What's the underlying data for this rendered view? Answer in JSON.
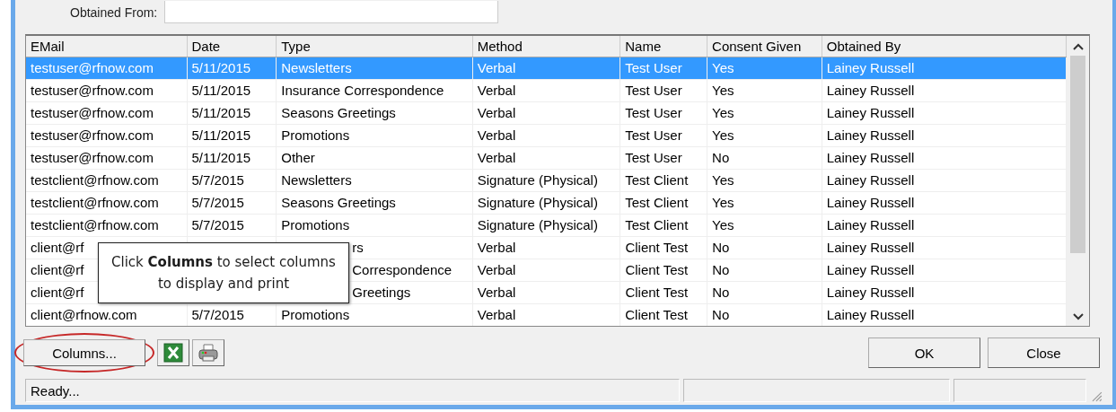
{
  "form": {
    "obtained_from_label": "Obtained From:"
  },
  "table": {
    "columns": [
      "EMail",
      "Date",
      "Type",
      "Method",
      "Name",
      "Consent Given",
      "Obtained By"
    ],
    "rows": [
      {
        "selected": true,
        "covered": false,
        "cells": [
          "testuser@rfnow.com",
          "5/11/2015",
          "Newsletters",
          "Verbal",
          "Test User",
          "Yes",
          "Lainey Russell"
        ]
      },
      {
        "selected": false,
        "covered": false,
        "cells": [
          "testuser@rfnow.com",
          "5/11/2015",
          "Insurance Correspondence",
          "Verbal",
          "Test User",
          "Yes",
          "Lainey Russell"
        ]
      },
      {
        "selected": false,
        "covered": false,
        "cells": [
          "testuser@rfnow.com",
          "5/11/2015",
          "Seasons Greetings",
          "Verbal",
          "Test User",
          "Yes",
          "Lainey Russell"
        ]
      },
      {
        "selected": false,
        "covered": false,
        "cells": [
          "testuser@rfnow.com",
          "5/11/2015",
          "Promotions",
          "Verbal",
          "Test User",
          "Yes",
          "Lainey Russell"
        ]
      },
      {
        "selected": false,
        "covered": false,
        "cells": [
          "testuser@rfnow.com",
          "5/11/2015",
          "Other",
          "Verbal",
          "Test User",
          "No",
          "Lainey Russell"
        ]
      },
      {
        "selected": false,
        "covered": false,
        "cells": [
          "testclient@rfnow.com",
          "5/7/2015",
          "Newsletters",
          "Signature (Physical)",
          "Test Client",
          "Yes",
          "Lainey Russell"
        ]
      },
      {
        "selected": false,
        "covered": false,
        "cells": [
          "testclient@rfnow.com",
          "5/7/2015",
          "Seasons Greetings",
          "Signature (Physical)",
          "Test Client",
          "Yes",
          "Lainey Russell"
        ]
      },
      {
        "selected": false,
        "covered": false,
        "cells": [
          "testclient@rfnow.com",
          "5/7/2015",
          "Promotions",
          "Signature (Physical)",
          "Test Client",
          "Yes",
          "Lainey Russell"
        ]
      },
      {
        "selected": false,
        "covered": true,
        "cells": [
          "client@rf",
          "",
          "rs",
          "Verbal",
          "Client Test",
          "No",
          "Lainey Russell"
        ]
      },
      {
        "selected": false,
        "covered": true,
        "cells": [
          "client@rf",
          "",
          "Correspondence",
          "Verbal",
          "Client Test",
          "No",
          "Lainey Russell"
        ]
      },
      {
        "selected": false,
        "covered": true,
        "cells": [
          "client@rf",
          "",
          "Greetings",
          "Verbal",
          "Client Test",
          "No",
          "Lainey Russell"
        ]
      },
      {
        "selected": false,
        "covered": false,
        "cells": [
          "client@rfnow.com",
          "5/7/2015",
          "Promotions",
          "Verbal",
          "Client Test",
          "No",
          "Lainey Russell"
        ]
      }
    ]
  },
  "tooltip": {
    "text": "Click **Columns** to select columns to display and print"
  },
  "buttons": {
    "columns": "Columns...",
    "ok": "OK",
    "close": "Close"
  },
  "status_bar": {
    "text": "Ready..."
  }
}
